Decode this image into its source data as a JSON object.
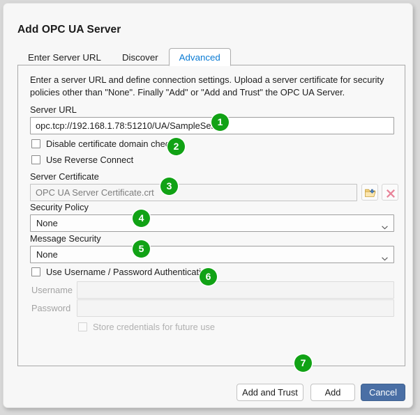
{
  "dialog": {
    "title": "Add OPC UA Server"
  },
  "tabs": [
    {
      "label": "Enter Server URL",
      "active": false
    },
    {
      "label": "Discover",
      "active": false
    },
    {
      "label": "Advanced",
      "active": true
    }
  ],
  "panel": {
    "intro": "Enter a server URL and define connection settings. Upload a server certificate for security policies other than \"None\". Finally \"Add\" or \"Add and Trust\" the OPC UA Server.",
    "server_url": {
      "label": "Server URL",
      "value": "opc.tcp://192.168.1.78:51210/UA/SampleServer"
    },
    "disable_cert_domain_check": {
      "label": "Disable certificate domain check",
      "checked": false
    },
    "use_reverse_connect": {
      "label": "Use Reverse Connect",
      "checked": false
    },
    "server_certificate": {
      "label": "Server Certificate",
      "value": "OPC UA Server Certificate.crt",
      "browse_icon": "open-folder-icon",
      "clear_icon": "delete-x-icon"
    },
    "security_policy": {
      "label": "Security Policy",
      "value": "None",
      "options": [
        "None"
      ]
    },
    "message_security": {
      "label": "Message Security",
      "value": "None",
      "options": [
        "None"
      ]
    },
    "use_username_password_auth": {
      "label": "Use Username / Password Authentication",
      "checked": false
    },
    "username": {
      "label": "Username",
      "value": "",
      "disabled": true
    },
    "password": {
      "label": "Password",
      "value": "",
      "disabled": true
    },
    "store_credentials": {
      "label": "Store credentials for future use",
      "checked": false,
      "disabled": true
    }
  },
  "footer": {
    "add_and_trust_label": "Add and Trust",
    "add_label": "Add",
    "cancel_label": "Cancel"
  },
  "annotations": [
    {
      "number": "1"
    },
    {
      "number": "2"
    },
    {
      "number": "3"
    },
    {
      "number": "4"
    },
    {
      "number": "5"
    },
    {
      "number": "6"
    },
    {
      "number": "7"
    }
  ],
  "colors": {
    "badge_green": "#11a215",
    "active_tab_text": "#0a7bd4",
    "primary_button": "#4a6fa5"
  }
}
